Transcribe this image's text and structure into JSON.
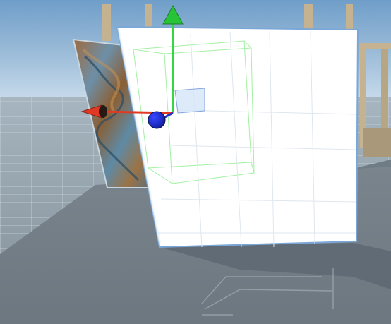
{
  "scene": {
    "colors": {
      "sky_top": "#6f9ec9",
      "sky_bottom": "#c5d9ea",
      "ground": "#7b858d",
      "shadow": "#5b6670",
      "cube_face": "#ffffff",
      "gizmo_x": "#e03a24",
      "gizmo_y": "#34d641",
      "gizmo_z": "#2430c9",
      "bounds": "#9ff09f",
      "tile_grid": "#a8bcc9",
      "wood": "#c4b291",
      "texture_primary": "#8b5e33",
      "texture_secondary": "#5e8aa6"
    },
    "toolbar": {
      "tabs": [
        {
          "name": "toolbar-tab-move",
          "color": "#2b5a8a"
        },
        {
          "name": "toolbar-tab-rotate",
          "color": "#44494f"
        },
        {
          "name": "toolbar-tab-scale",
          "color": "#44494f"
        }
      ]
    },
    "objects": {
      "selected_cube": "white-cube",
      "textured_panel": "rusty-marble-panel",
      "gizmo": "transform-move-gizmo"
    }
  }
}
